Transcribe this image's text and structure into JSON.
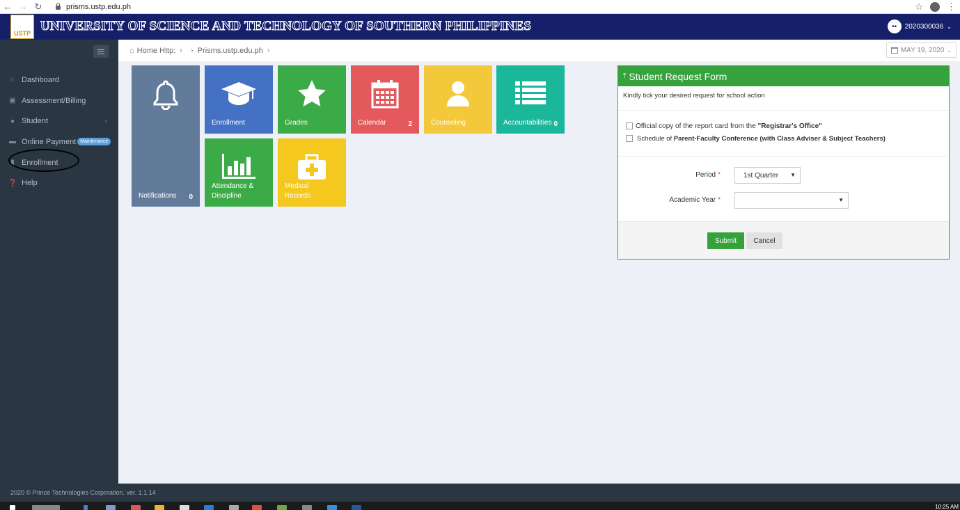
{
  "browser": {
    "url": "prisms.ustp.edu.ph"
  },
  "header": {
    "logo_text": "USTP",
    "title": "UNIVERSITY OF SCIENCE AND TECHNOLOGY OF SOUTHERN PHILIPPINES",
    "user_id": "2020300036",
    "brand_color": "#16206a"
  },
  "sidebar": {
    "items": [
      {
        "label": "Dashboard",
        "icon": "home-icon"
      },
      {
        "label": "Assessment/Billing",
        "icon": "money-icon"
      },
      {
        "label": "Student",
        "icon": "user-icon"
      },
      {
        "label": "Online Payment",
        "icon": "card-icon",
        "badge": "Maintenance"
      },
      {
        "label": "Enrollment",
        "icon": "book-icon"
      },
      {
        "label": "Help",
        "icon": "question-icon"
      }
    ]
  },
  "breadcrumb": {
    "home": "Home Http:",
    "site": "Prisms.ustp.edu.ph"
  },
  "date": "MAY 19, 2020",
  "tiles": {
    "notifications": {
      "label": "Notifications",
      "count": "0",
      "color": "#637b9b"
    },
    "enrollment": {
      "label": "Enrollment",
      "color": "#4471c4"
    },
    "grades": {
      "label": "Grades",
      "color": "#3aab46"
    },
    "calendar": {
      "label": "Calendar",
      "count": "2",
      "color": "#e3595c"
    },
    "counseling": {
      "label": "Counseling",
      "color": "#f4c83b"
    },
    "accountabilities": {
      "label": "Accountabilities",
      "count": "0",
      "color": "#1bb79b"
    },
    "attendance": {
      "label_line1": "Attendance &",
      "label_line2": "Discipline",
      "color": "#3aab46"
    },
    "medical": {
      "label_line1": "Medical",
      "label_line2": "Records",
      "color": "#f4c81e"
    }
  },
  "form": {
    "title": "Student Request Form",
    "description": "Kindly tick your desired request for school action",
    "option1_prefix": "Official copy of the report card from the ",
    "option1_bold": "\"Registrar's Office\"",
    "option2_prefix": "Schedule of ",
    "option2_bold": "Parent-Faculty Conference (with Class Adviser & Subject Teachers)",
    "period_label": "Period",
    "period_value": "1st Quarter",
    "year_label": "Academic Year",
    "year_value": "",
    "required_mark": "*",
    "submit_label": "Submit",
    "cancel_label": "Cancel",
    "accent": "#36a23c"
  },
  "footer": {
    "text": "2020 © Prince Technologies Corporation. ver. 1.1.14"
  },
  "taskbar": {
    "time": "10:25 AM"
  }
}
